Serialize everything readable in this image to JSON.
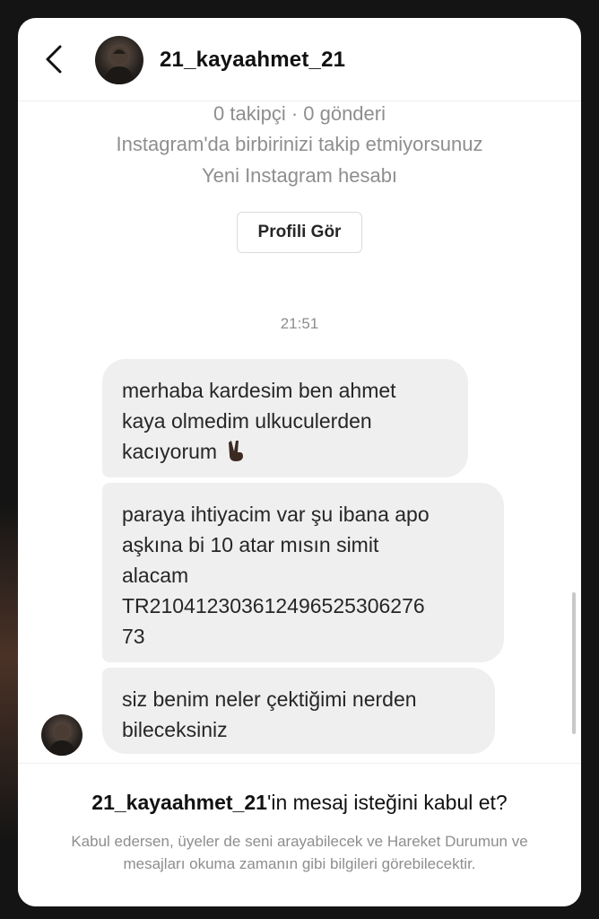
{
  "header": {
    "back_icon": "chevron-left-icon",
    "username": "21_kayaahmet_21"
  },
  "profile_info": {
    "stats": "0 takipçi · 0 gönderi",
    "follow_status": "Instagram'da birbirinizi takip etmiyorsunuz",
    "account_note": "Yeni Instagram hesabı",
    "view_profile_label": "Profili Gör"
  },
  "conversation": {
    "timestamp": "21:51",
    "messages": [
      {
        "text": "merhaba kardesim ben ahmet\nkaya olmedim ulkuculerden\nkacıyorum",
        "emoji": "victory-hand-emoji"
      },
      {
        "text": "paraya ihtiyacim var şu ibana apo\naşkına bi 10 atar mısın simit\nalacam\nTR21041230361249652530627​6\n73"
      },
      {
        "text": "siz benim neler çektiğimi nerden\nbileceksiniz"
      }
    ]
  },
  "request": {
    "username": "21_kayaahmet_21",
    "title_suffix": "'in mesaj isteğini kabul et?",
    "description": "Kabul edersen, üyeler de seni arayabilecek ve Hareket Durumun ve mesajları okuma zamanın gibi bilgileri görebilecektir."
  },
  "colors": {
    "bubble": "#efefef",
    "secondary_text": "#8e8e8e",
    "primary_text": "#262626",
    "outer_background": "#141414"
  }
}
